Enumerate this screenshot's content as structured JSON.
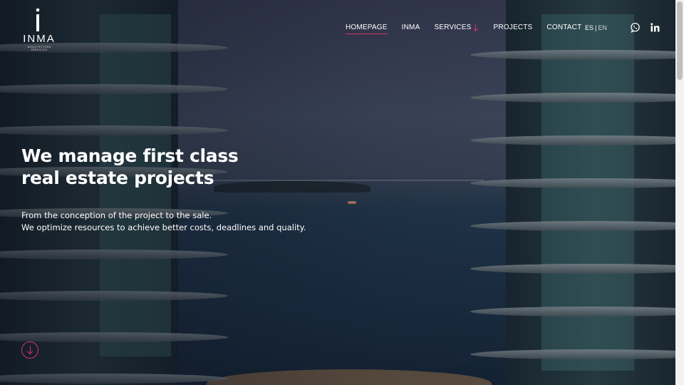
{
  "brand": {
    "name": "INMA",
    "tagline": "ARQUITECTURA SERVICIOS"
  },
  "nav": {
    "items": [
      {
        "label": "HOMEPAGE",
        "active": true
      },
      {
        "label": "INMA",
        "active": false
      },
      {
        "label": "SERVICES",
        "active": false,
        "has_dropdown": true
      },
      {
        "label": "PROJECTS",
        "active": false
      },
      {
        "label": "CONTACT",
        "active": false
      }
    ]
  },
  "language": {
    "es": "ES",
    "separator": "|",
    "en": "EN"
  },
  "social": {
    "icons": [
      "whatsapp-icon",
      "linkedin-icon"
    ]
  },
  "hero": {
    "headline_line1": "We manage first class",
    "headline_line2": "real estate projects",
    "subtitle_line1": "From the conception of the project to the sale.",
    "subtitle_line2": "We optimize resources to achieve better costs, deadlines and quality."
  },
  "colors": {
    "accent": "#d6336c",
    "text": "#ffffff"
  }
}
